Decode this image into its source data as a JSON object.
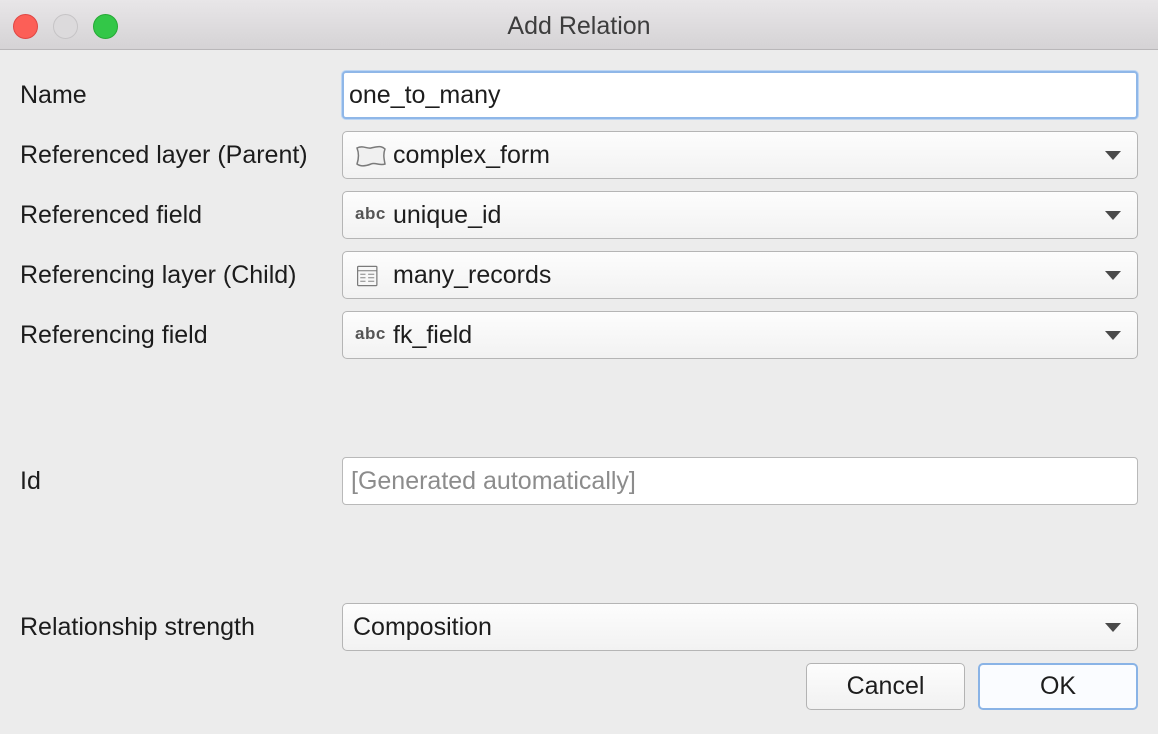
{
  "window": {
    "title": "Add Relation"
  },
  "form": {
    "name": {
      "label": "Name",
      "value": "one_to_many"
    },
    "referenced_layer": {
      "label": "Referenced layer (Parent)",
      "value": "complex_form",
      "icon": "polygon-layer-icon"
    },
    "referenced_field": {
      "label": "Referenced field",
      "value": "unique_id",
      "icon_text": "abc"
    },
    "referencing_layer": {
      "label": "Referencing layer (Child)",
      "value": "many_records",
      "icon": "table-layer-icon"
    },
    "referencing_field": {
      "label": "Referencing field",
      "value": "fk_field",
      "icon_text": "abc"
    },
    "id": {
      "label": "Id",
      "placeholder": "[Generated automatically]"
    },
    "strength": {
      "label": "Relationship strength",
      "value": "Composition"
    }
  },
  "buttons": {
    "cancel": "Cancel",
    "ok": "OK"
  },
  "colors": {
    "close": "#fc5f57",
    "minimize": "#dcdadc",
    "maximize": "#33c748",
    "focus": "#8fb7e8"
  }
}
